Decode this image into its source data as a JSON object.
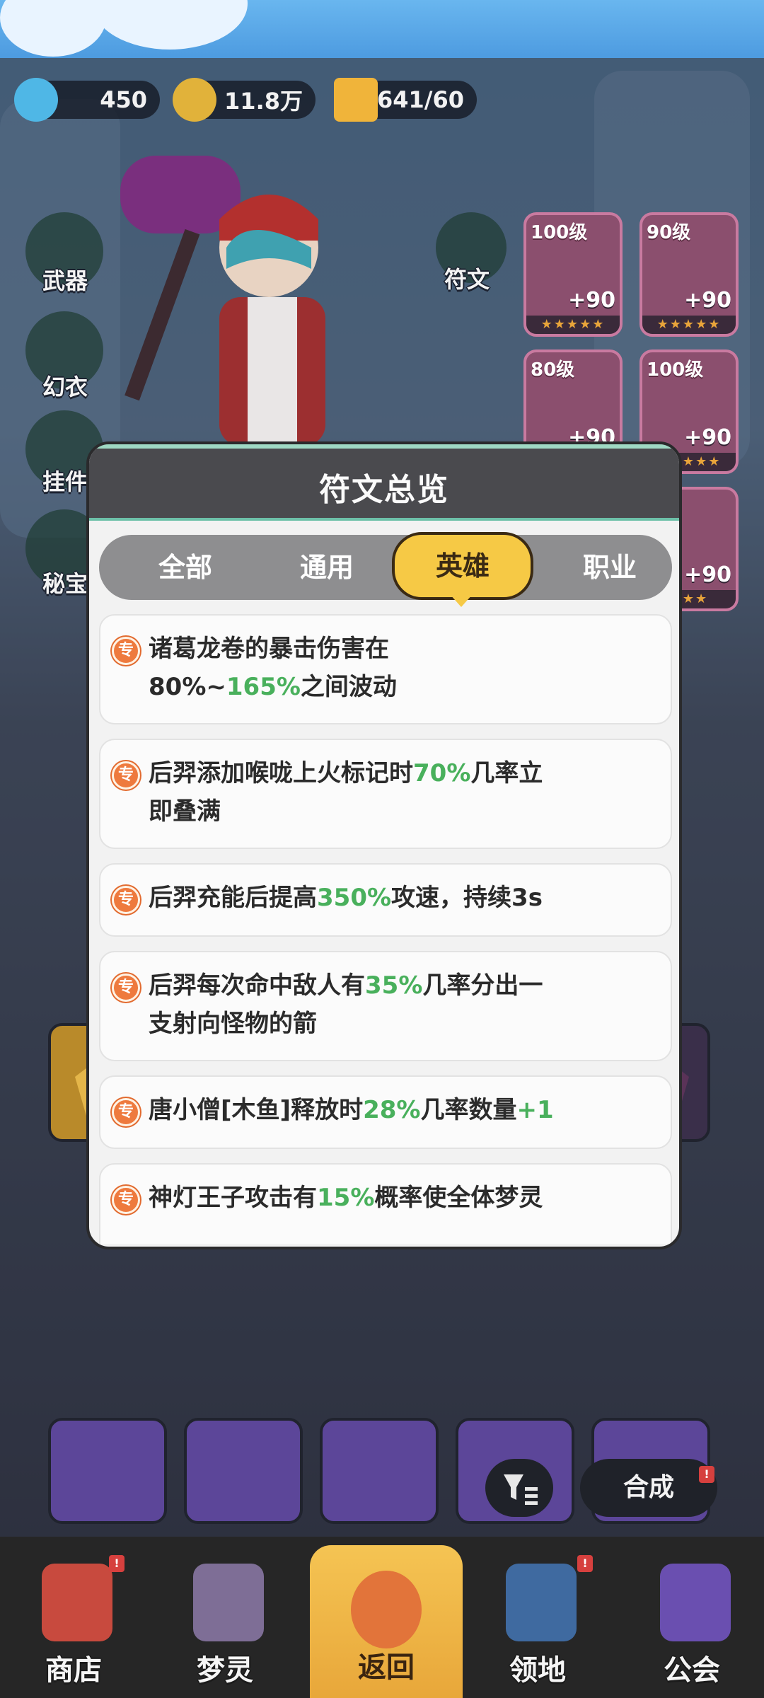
{
  "currencies": [
    {
      "icon": "diamond-icon",
      "value": "450"
    },
    {
      "icon": "gold-coin-icon",
      "value": "11.8万"
    },
    {
      "icon": "energy-bolt-icon",
      "value": "641/60"
    }
  ],
  "side_menu": [
    "武器",
    "幻衣",
    "挂件",
    "秘宝"
  ],
  "rune_label": "符文",
  "equipment": [
    {
      "level": "100级",
      "plus": "+90",
      "stars": "★★★★★"
    },
    {
      "level": "90级",
      "plus": "+90",
      "stars": "★★★★★"
    },
    {
      "level": "80级",
      "plus": "+90",
      "stars": "★★★★★"
    },
    {
      "level": "100级",
      "plus": "+90",
      "stars": "★★★★★"
    },
    {
      "level": "",
      "plus": "+90",
      "stars": "★★★"
    }
  ],
  "grid_badge_count": "2",
  "merge_button": "合成",
  "popup": {
    "title": "符文总览",
    "tabs": [
      "全部",
      "通用",
      "英雄",
      "职业"
    ],
    "active_tab": "英雄",
    "badge_char": "专",
    "items": [
      {
        "parts": [
          {
            "t": "诸葛龙卷的暴击伤害在"
          },
          {
            "br": true
          },
          {
            "t": "80%~"
          },
          {
            "t": "165%",
            "hl": true
          },
          {
            "t": "之间波动"
          }
        ]
      },
      {
        "parts": [
          {
            "t": "后羿添加喉咙上火标记时"
          },
          {
            "t": "70%",
            "hl": true
          },
          {
            "t": "几率立"
          },
          {
            "br": true
          },
          {
            "t": "即叠满"
          }
        ]
      },
      {
        "parts": [
          {
            "t": "后羿充能后提高"
          },
          {
            "t": "350%",
            "hl": true
          },
          {
            "t": "攻速，持续3s"
          }
        ]
      },
      {
        "parts": [
          {
            "t": "后羿每次命中敌人有"
          },
          {
            "t": "35%",
            "hl": true
          },
          {
            "t": "几率分出一"
          },
          {
            "br": true
          },
          {
            "t": "支射向怪物的箭"
          }
        ]
      },
      {
        "parts": [
          {
            "t": "唐小僧[木鱼]释放时"
          },
          {
            "t": "28%",
            "hl": true
          },
          {
            "t": "几率数量"
          },
          {
            "t": "+1",
            "hl": true
          }
        ]
      },
      {
        "parts": [
          {
            "t": "神灯王子攻击有"
          },
          {
            "t": "15%",
            "hl": true
          },
          {
            "t": "概率使全体梦灵"
          }
        ]
      }
    ]
  },
  "bottom_nav": [
    {
      "label": "商店",
      "icon": "shop-icon"
    },
    {
      "label": "梦灵",
      "icon": "robot-icon"
    },
    {
      "label": "返回",
      "icon": "return-arrow-icon"
    },
    {
      "label": "领地",
      "icon": "territory-icon"
    },
    {
      "label": "公会",
      "icon": "guild-icon"
    }
  ],
  "colors": {
    "highlight": "#49b05c",
    "active_tab": "#f6c945",
    "badge": "#ee7a3e"
  }
}
